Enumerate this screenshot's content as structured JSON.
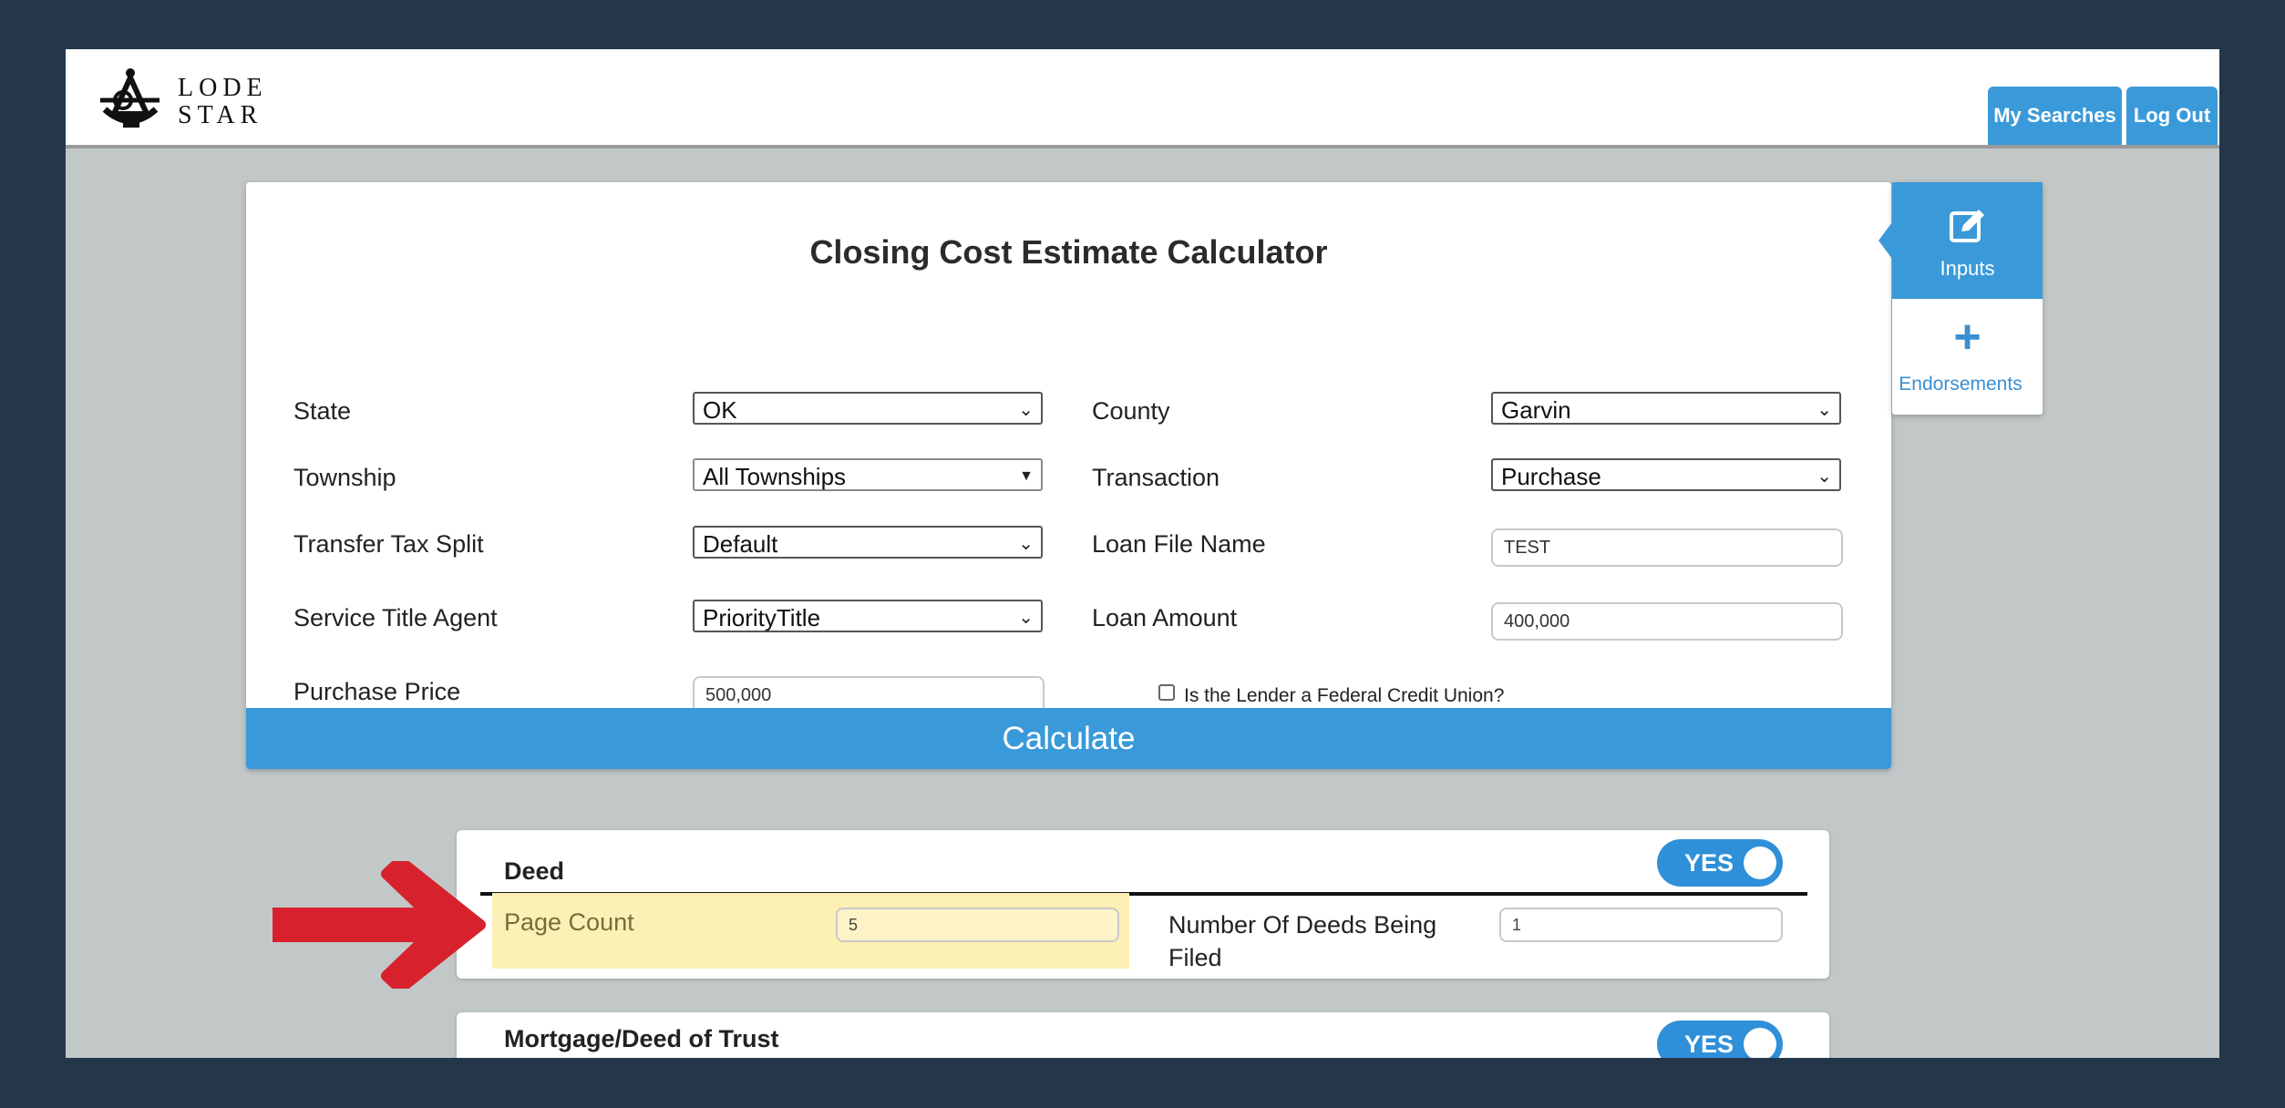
{
  "header": {
    "logo_text_line1": "LODE",
    "logo_text_line2": "STAR",
    "my_searches_label": "My Searches",
    "log_out_label": "Log Out"
  },
  "calculator": {
    "title": "Closing Cost Estimate Calculator",
    "state": {
      "label": "State",
      "value": "OK"
    },
    "county": {
      "label": "County",
      "value": "Garvin"
    },
    "township": {
      "label": "Township",
      "value": "All Townships"
    },
    "transaction": {
      "label": "Transaction",
      "value": "Purchase"
    },
    "transfer_tax_split": {
      "label": "Transfer Tax Split",
      "value": "Default"
    },
    "loan_file_name": {
      "label": "Loan File Name",
      "value": "TEST"
    },
    "service_title_agent": {
      "label": "Service Title Agent",
      "value": "PriorityTitle"
    },
    "loan_amount": {
      "label": "Loan Amount",
      "value": "400,000"
    },
    "purchase_price": {
      "label": "Purchase Price",
      "value": "500,000"
    },
    "federal_credit_union": {
      "label": "Is the Lender a Federal Credit Union?",
      "checked": false
    },
    "calculate_label": "Calculate"
  },
  "side_tabs": {
    "inputs_label": "Inputs",
    "inputs_icon": "edit-icon",
    "endorsements_label": "Endorsements",
    "endorsements_icon": "plus-icon"
  },
  "deed": {
    "title": "Deed",
    "toggle_label": "YES",
    "page_count_label": "Page Count",
    "page_count_value": "5",
    "deeds_filed_label": "Number Of Deeds Being Filed",
    "deeds_filed_value": "1"
  },
  "mortgage": {
    "title": "Mortgage/Deed of Trust",
    "toggle_label": "YES"
  },
  "colors": {
    "accent": "#3a9ad9",
    "frame": "#24374a",
    "highlight": "#fdf0b4",
    "arrow": "#d7222e"
  }
}
